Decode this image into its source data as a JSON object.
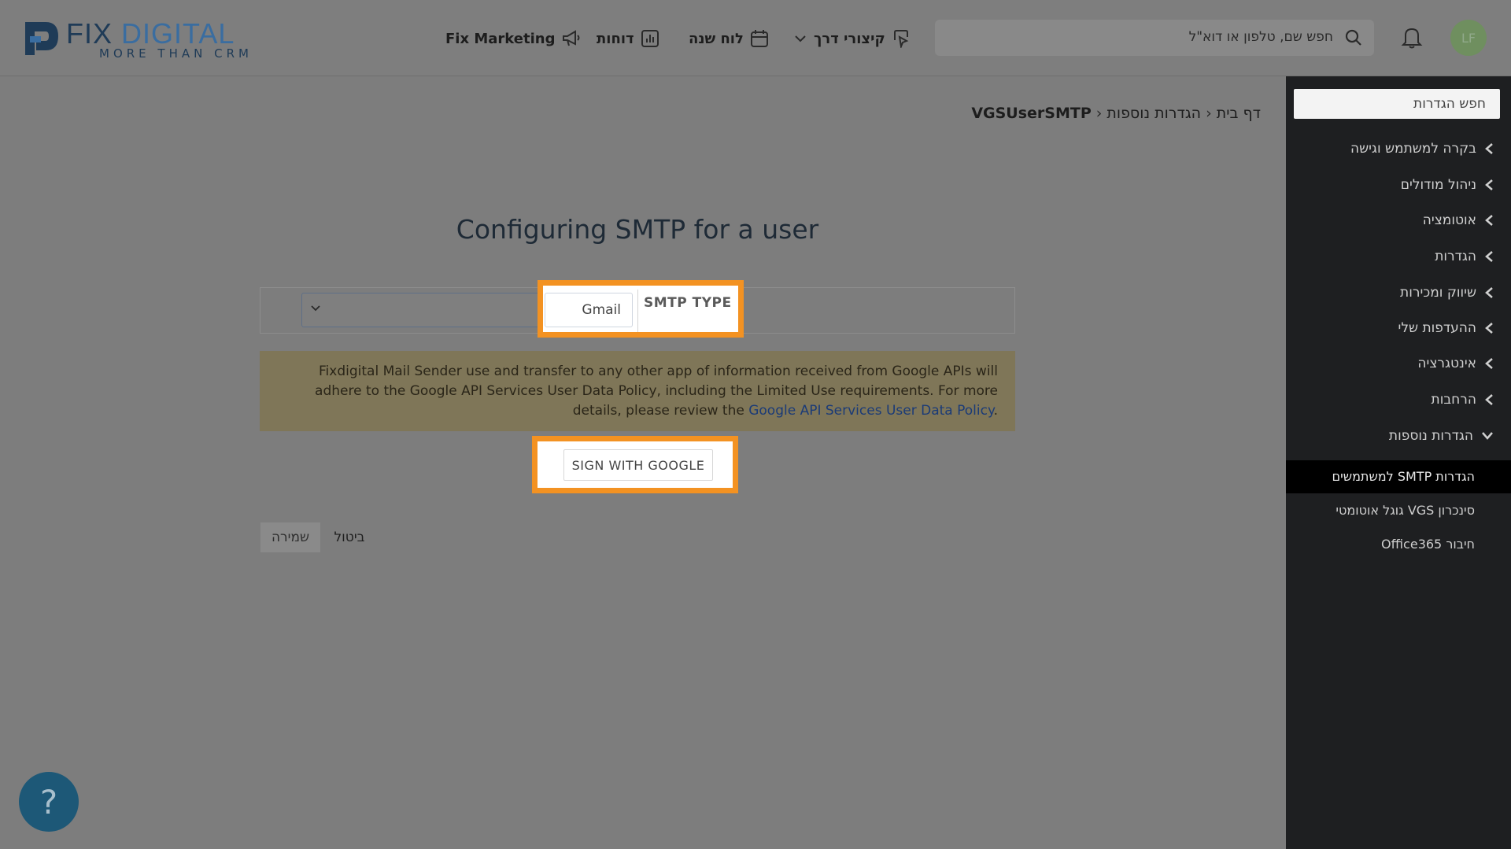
{
  "header": {
    "logo": {
      "brand_left": "FIX",
      "brand_right": "DIGITAL",
      "tagline": "MORE THAN CRM"
    },
    "nav": {
      "marketing": "Fix Marketing",
      "reports": "דוחות",
      "calendar": "לוח שנה",
      "shortcuts": "קיצורי דרך"
    },
    "search_placeholder": "חפש שם, טלפון או דוא\"ל",
    "avatar_initials": "LF"
  },
  "sidebar": {
    "search_placeholder": "חפש הגדרות",
    "items": [
      {
        "label": "בקרה למשתמש וגישה"
      },
      {
        "label": "ניהול מודולים"
      },
      {
        "label": "אוטומציה"
      },
      {
        "label": "הגדרות"
      },
      {
        "label": "שיווק ומכירות"
      },
      {
        "label": "ההעדפות שלי"
      },
      {
        "label": "אינטגרציה"
      },
      {
        "label": "הרחבות"
      },
      {
        "label": "הגדרות נוספות"
      }
    ],
    "sub_items": [
      {
        "label": "הגדרות SMTP למשתמשים"
      },
      {
        "label": "סינכרון VGS גוגל אוטומטי"
      },
      {
        "label": "חיבור Office365"
      }
    ]
  },
  "breadcrumb": {
    "home": "דף בית",
    "section": "הגדרות נוספות",
    "current": "VGSUserSMTP"
  },
  "main": {
    "title": "Configuring SMTP for a user",
    "smtp_type_label": "SMTP TYPE",
    "smtp_type_value": "Gmail",
    "notice_text": "Fixdigital Mail Sender use and transfer to any other app of information received from Google APIs will adhere to the Google API Services User Data Policy, including the Limited Use requirements. For more details, please review the",
    "notice_link": "Google API Services User Data Policy",
    "notice_tail": ".",
    "google_button": "SIGN WITH GOOGLE",
    "save_button": "שמירה",
    "cancel_button": "ביטול"
  },
  "help_label": "?",
  "colors": {
    "highlight": "#f39222",
    "sidebar_bg": "#1e1f21",
    "help_bg": "#1d5877",
    "notice_bg": "#7f7658"
  }
}
